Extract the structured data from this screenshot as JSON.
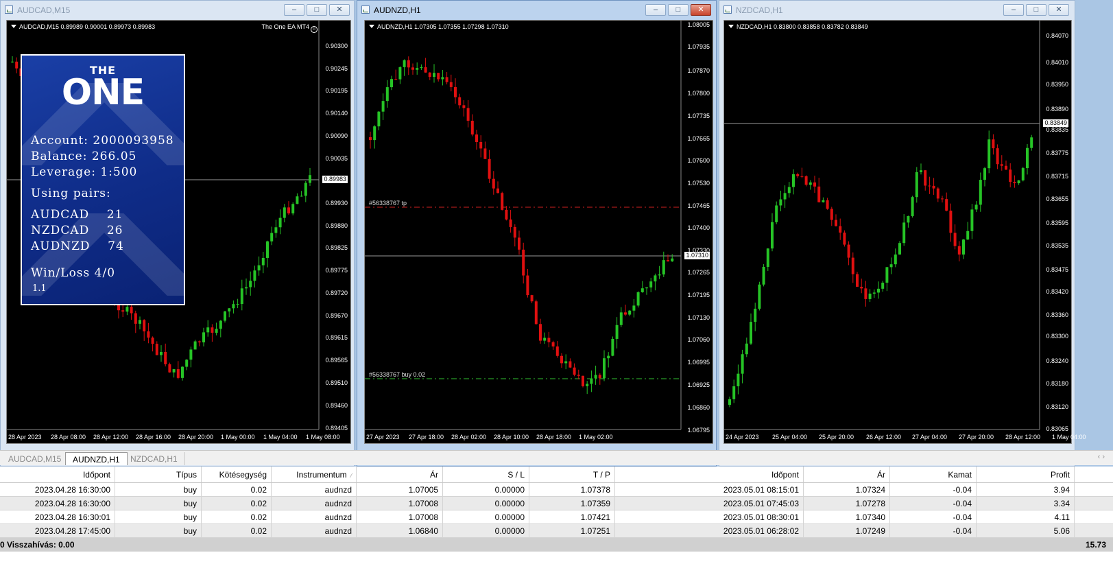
{
  "windows": [
    {
      "title": "AUDCAD,M15",
      "header": "AUDCAD,M15  0.89989 0.90001 0.89973 0.89983",
      "ea_label": "The One EA MT4",
      "current_price": "0.89983",
      "y_labels": [
        "0.90300",
        "0.90245",
        "0.90195",
        "0.90140",
        "0.90090",
        "0.90035",
        "0.89983",
        "0.89930",
        "0.89880",
        "0.89825",
        "0.89775",
        "0.89720",
        "0.89670",
        "0.89615",
        "0.89565",
        "0.89510",
        "0.89460",
        "0.89405"
      ],
      "x_labels": [
        "28 Apr 2023",
        "28 Apr 08:00",
        "28 Apr 12:00",
        "28 Apr 16:00",
        "28 Apr 20:00",
        "1 May 00:00",
        "1 May 04:00",
        "1 May 08:00"
      ]
    },
    {
      "title": "AUDNZD,H1",
      "header": "AUDNZD,H1  1.07305 1.07355 1.07298 1.07310",
      "current_price": "1.07310",
      "tp_label": "#56338767 tp",
      "buy_label": "#56338767 buy 0.02",
      "y_labels": [
        "1.08005",
        "1.07935",
        "1.07870",
        "1.07800",
        "1.07735",
        "1.07665",
        "1.07600",
        "1.07530",
        "1.07465",
        "1.07400",
        "1.07330",
        "1.07310",
        "1.07265",
        "1.07195",
        "1.07130",
        "1.07060",
        "1.06995",
        "1.06925",
        "1.06860",
        "1.06795"
      ],
      "x_labels": [
        "27 Apr 2023",
        "27 Apr 18:00",
        "28 Apr 02:00",
        "28 Apr 10:00",
        "28 Apr 18:00",
        "1 May 02:00"
      ]
    },
    {
      "title": "NZDCAD,H1",
      "header": "NZDCAD,H1  0.83800 0.83858 0.83782 0.83849",
      "current_price": "0.83849",
      "y_labels": [
        "0.84070",
        "0.84010",
        "0.83950",
        "0.83890",
        "0.83849",
        "0.83835",
        "0.83775",
        "0.83715",
        "0.83655",
        "0.83595",
        "0.83535",
        "0.83475",
        "0.83420",
        "0.83360",
        "0.83300",
        "0.83240",
        "0.83180",
        "0.83120",
        "0.83065"
      ],
      "x_labels": [
        "24 Apr 2023",
        "25 Apr 04:00",
        "25 Apr 20:00",
        "26 Apr 12:00",
        "27 Apr 04:00",
        "27 Apr 20:00",
        "28 Apr 12:00",
        "1 May 04:00"
      ]
    }
  ],
  "ea_panel": {
    "logo_the": "THE",
    "logo_one": "ONE",
    "account": "Account: 2000093958",
    "balance": "Balance: 266.05",
    "leverage": "Leverage: 1:500",
    "using_pairs": "Using pairs:",
    "pairs": [
      "AUDCAD    21",
      "NZDCAD    26",
      "AUDNZD    74"
    ],
    "winloss": "Win/Loss 4/0",
    "version": "1.1"
  },
  "tabs": [
    "AUDCAD,M15",
    "AUDNZD,H1",
    "NZDCAD,H1"
  ],
  "tab_arrows": "‹  ›",
  "table": {
    "headers": [
      "Időpont",
      "Típus",
      "Kötésegység",
      "Instrumentum",
      "Ár",
      "S / L",
      "T / P",
      "Időpont",
      "Ár",
      "Kamat",
      "Profit"
    ],
    "rows": [
      [
        "2023.04.28 16:30:00",
        "buy",
        "0.02",
        "audnzd",
        "1.07005",
        "0.00000",
        "1.07378",
        "2023.05.01 08:15:01",
        "1.07324",
        "-0.04",
        "3.94"
      ],
      [
        "2023.04.28 16:30:00",
        "buy",
        "0.02",
        "audnzd",
        "1.07008",
        "0.00000",
        "1.07359",
        "2023.05.01 07:45:03",
        "1.07278",
        "-0.04",
        "3.34"
      ],
      [
        "2023.04.28 16:30:01",
        "buy",
        "0.02",
        "audnzd",
        "1.07008",
        "0.00000",
        "1.07421",
        "2023.05.01 08:30:01",
        "1.07340",
        "-0.04",
        "4.11"
      ],
      [
        "2023.04.28 17:45:00",
        "buy",
        "0.02",
        "audnzd",
        "1.06840",
        "0.00000",
        "1.07251",
        "2023.05.01 06:28:02",
        "1.07249",
        "-0.04",
        "5.06"
      ]
    ],
    "total_label": "0  Visszahívás: 0.00",
    "total_profit": "15.73"
  },
  "colors": {
    "bull": "#26c426",
    "bear": "#e01010",
    "chart_bg": "#000000",
    "panel_blue": "#12349a"
  },
  "window_buttons": {
    "minimize": "–",
    "maximize": "□",
    "close": "✕"
  }
}
